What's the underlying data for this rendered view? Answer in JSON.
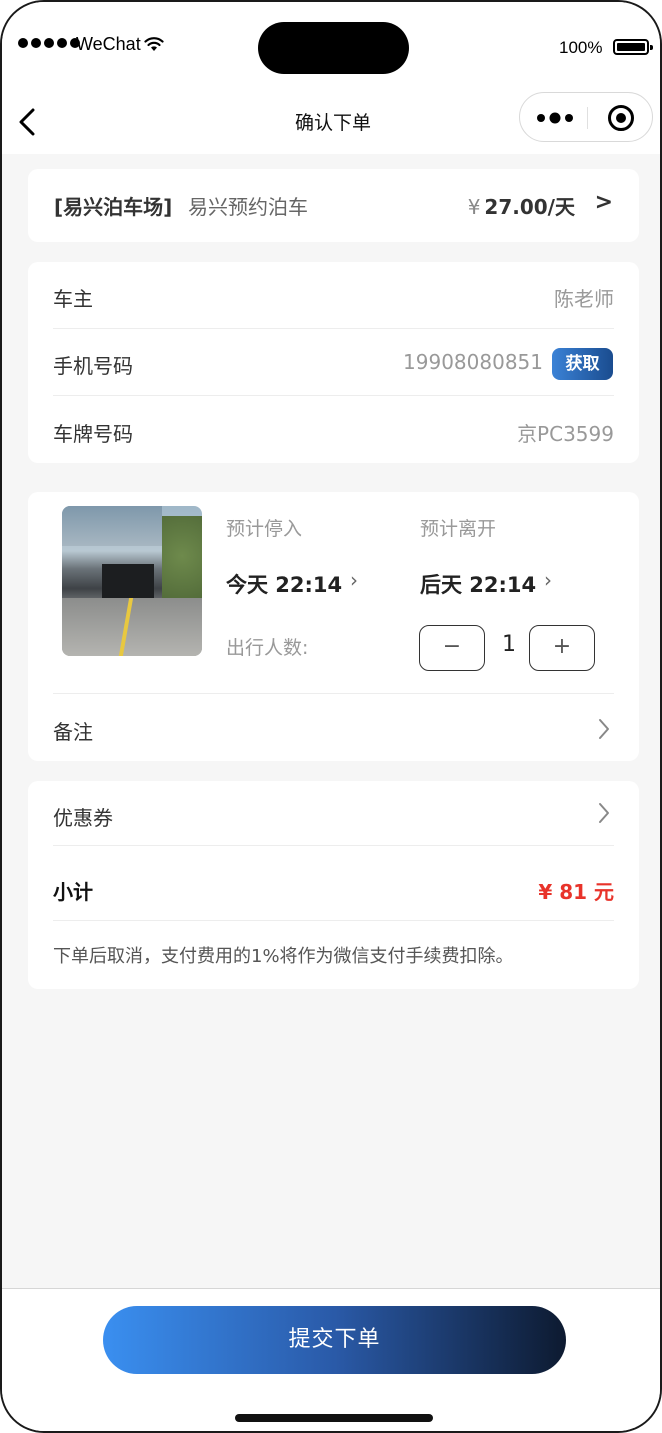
{
  "status_bar": {
    "carrier": "WeChat",
    "battery": "100%"
  },
  "nav": {
    "title": "确认下单"
  },
  "store": {
    "name": "[易兴泊车场]",
    "product": "易兴预约泊车",
    "price_symbol": "¥",
    "price": "27.00/天",
    "arrow": ">"
  },
  "owner": {
    "owner_label": "车主",
    "owner_value": "陈老师",
    "phone_label": "手机号码",
    "phone_value": "19908080851",
    "fetch_label": "获取",
    "plate_label": "车牌号码",
    "plate_value": "京PC3599"
  },
  "booking": {
    "enter_label": "预计停入",
    "enter_time": "今天 22:14",
    "leave_label": "预计离开",
    "leave_time": "后天 22:14",
    "chevron": "›",
    "people_label": "出行人数:",
    "minus": "−",
    "people_count": "1",
    "plus": "+",
    "remark_label": "备注"
  },
  "summary": {
    "coupon_label": "优惠券",
    "subtotal_label": "小计",
    "subtotal_value": "¥ 81 元",
    "notice": "下单后取消，支付费用的1%将作为微信支付手续费扣除。"
  },
  "footer": {
    "submit_label": "提交下单"
  }
}
